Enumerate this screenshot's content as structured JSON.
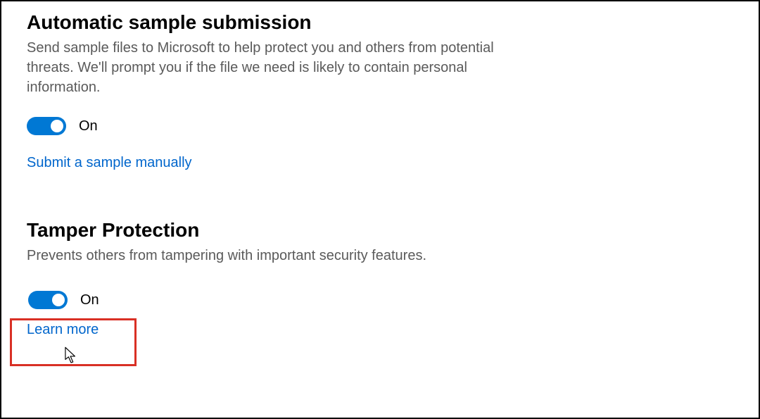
{
  "colors": {
    "accent": "#0078d4",
    "link": "#0066cc",
    "highlight": "#d93025",
    "text_muted": "#5a5a5a"
  },
  "sections": {
    "auto_submit": {
      "heading": "Automatic sample submission",
      "description": "Send sample files to Microsoft to help protect you and others from potential threats. We'll prompt you if the file we need is likely to contain personal information.",
      "toggle_state": "On",
      "manual_link": "Submit a sample manually"
    },
    "tamper": {
      "heading": "Tamper Protection",
      "description": "Prevents others from tampering with important security features.",
      "toggle_state": "On",
      "learn_more": "Learn more"
    }
  }
}
